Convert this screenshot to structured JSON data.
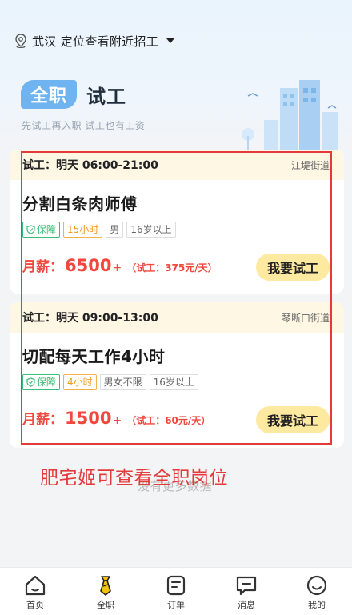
{
  "location": {
    "text": "武汉 定位查看附近招工",
    "icon": "location-pin-icon"
  },
  "mode": {
    "active": "全职",
    "other": "试工",
    "slogan": "先试工再入职 试工也有工资"
  },
  "jobs": [
    {
      "trial_time": "试工：明天 06:00-21:00",
      "street": "江堤街道",
      "title": "分割白条肉师傅",
      "tags": {
        "guard": "保障",
        "hours": "15小时",
        "t3": "男",
        "t4": "16岁以上"
      },
      "salary_label": "月薪：",
      "salary_value": "6500",
      "salary_plus": "+",
      "salary_trial": "（试工：375元/天）",
      "button": "我要试工"
    },
    {
      "trial_time": "试工：明天 09:00-13:00",
      "street": "琴断口街道",
      "title": "切配每天工作4小时",
      "tags": {
        "guard": "保障",
        "hours": "4小时",
        "t3": "男女不限",
        "t4": "16岁以上"
      },
      "salary_label": "月薪：",
      "salary_value": "1500",
      "salary_plus": "+",
      "salary_trial": "（试工：60元/天）",
      "button": "我要试工"
    }
  ],
  "overlay_note": "肥宅姬可查看全职岗位",
  "no_more": "没有更多数据",
  "tabs": [
    {
      "label": "首页",
      "icon": "home-icon"
    },
    {
      "label": "全职",
      "icon": "tie-icon",
      "active": true
    },
    {
      "label": "订单",
      "icon": "order-icon"
    },
    {
      "label": "消息",
      "icon": "message-icon"
    },
    {
      "label": "我的",
      "icon": "profile-icon"
    }
  ],
  "colors": {
    "accent_blue": "#6fb3f0",
    "salary_red": "#f0483e",
    "button_yellow": "#fde9a0",
    "guard_green": "#3bbf76",
    "hours_orange": "#f29a1a",
    "annotation_red": "#e33b3b"
  }
}
